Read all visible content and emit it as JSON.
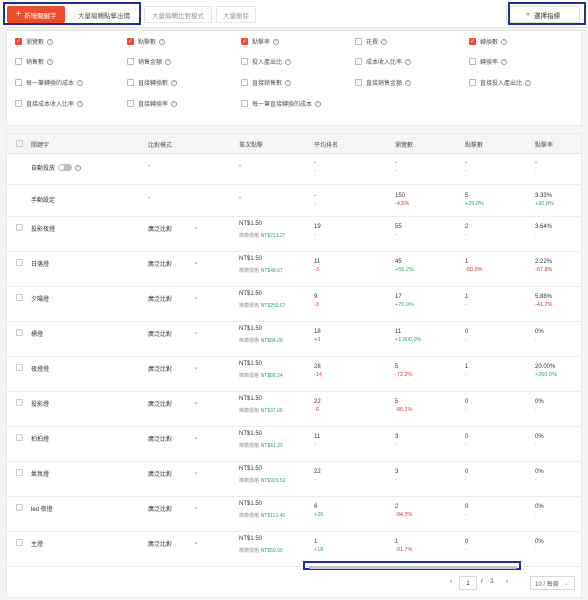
{
  "toolbar": {
    "add_label": "新增關鍵字",
    "bulk_bid_label": "大量編輯點擊出價",
    "bulk_match_label": "大量編輯比對模式",
    "bulk_delete_label": "大量刪除",
    "choose_metrics_label": "選擇指標"
  },
  "metrics": [
    {
      "label": "瀏覽數",
      "checked": true
    },
    {
      "label": "點擊數",
      "checked": true
    },
    {
      "label": "點擊率",
      "checked": true
    },
    {
      "label": "花費",
      "checked": false
    },
    {
      "label": "轉換數",
      "checked": true
    },
    {
      "label": "銷售數",
      "checked": false
    },
    {
      "label": "銷售金額",
      "checked": false
    },
    {
      "label": "投入產出比",
      "checked": false
    },
    {
      "label": "成本收入比率",
      "checked": false
    },
    {
      "label": "轉換率",
      "checked": false
    },
    {
      "label": "每一筆轉換的成本",
      "checked": false
    },
    {
      "label": "直接轉換數",
      "checked": false
    },
    {
      "label": "直接銷售數",
      "checked": false
    },
    {
      "label": "直接銷售金額",
      "checked": false
    },
    {
      "label": "直接投入產出比",
      "checked": false
    },
    {
      "label": "直接成本收入比率",
      "checked": false
    },
    {
      "label": "直接轉換率",
      "checked": false
    },
    {
      "label": "每一筆直接轉換的成本",
      "checked": false
    }
  ],
  "table": {
    "headers": [
      "關鍵字",
      "比對模式",
      "單次點擊",
      "平均排名",
      "瀏覽數",
      "點擊數",
      "點擊率"
    ],
    "auto": {
      "label": "自動投放",
      "match": "-",
      "bid": "-",
      "rank": "-",
      "rank_sub": "-",
      "views": "-",
      "views_sub": "-",
      "clicks": "-",
      "clicks_sub": "-",
      "ctr": "-",
      "ctr_sub": "-"
    },
    "manual": {
      "label": "手動設定",
      "match": "-",
      "bid": "-",
      "rank": "-",
      "rank_sub": "-",
      "views": "150",
      "views_sub": "-4.5%",
      "clicks": "5",
      "clicks_sub": "+25.0%",
      "ctr": "3.33%",
      "ctr_sub": "+30.8%"
    },
    "price_label": "推薦價格",
    "rows": [
      {
        "kw": "投影夜燈",
        "match": "廣泛比對",
        "bid": "NT$1.50",
        "price": "NT$213.27",
        "rank": "19",
        "rank_sub": "-",
        "views": "55",
        "views_sub": "-",
        "clicks": "2",
        "clicks_sub": "-",
        "ctr": "3.64%",
        "ctr_sub": "-"
      },
      {
        "kw": "日落燈",
        "match": "廣泛比對",
        "bid": "NT$1.50",
        "price": "NT$48.67",
        "rank": "11",
        "rank_sub": "-3",
        "views": "45",
        "views_sub": "+55.2%",
        "clicks": "1",
        "clicks_sub": "-50.0%",
        "ctr": "2.22%",
        "ctr_sub": "-67.8%"
      },
      {
        "kw": "夕陽燈",
        "match": "廣泛比對",
        "bid": "NT$1.50",
        "price": "NT$250.67",
        "rank": "9",
        "rank_sub": "-3",
        "views": "17",
        "views_sub": "+70.0%",
        "clicks": "1",
        "clicks_sub": "-",
        "ctr": "5.88%",
        "ctr_sub": "-41.2%"
      },
      {
        "kw": "標燈",
        "match": "廣泛比對",
        "bid": "NT$1.50",
        "price": "NT$84.29",
        "rank": "18",
        "rank_sub": "+9",
        "views": "11",
        "views_sub": "+1,000.0%",
        "clicks": "0",
        "clicks_sub": "-",
        "ctr": "0%",
        "ctr_sub": "-"
      },
      {
        "kw": "夜燈燈",
        "match": "廣泛比對",
        "bid": "NT$1.50",
        "price": "NT$88.24",
        "rank": "28",
        "rank_sub": "-14",
        "views": "5",
        "views_sub": "-72.2%",
        "clicks": "1",
        "clicks_sub": "-",
        "ctr": "20.00%",
        "ctr_sub": "+260.0%"
      },
      {
        "kw": "投影燈",
        "match": "廣泛比對",
        "bid": "NT$1.50",
        "price": "NT$37.65",
        "rank": "22",
        "rank_sub": "-6",
        "views": "5",
        "views_sub": "-86.1%",
        "clicks": "0",
        "clicks_sub": "-",
        "ctr": "0%",
        "ctr_sub": "-"
      },
      {
        "kw": "拍拍燈",
        "match": "廣泛比對",
        "bid": "NT$1.50",
        "price": "NT$41.23",
        "rank": "11",
        "rank_sub": "-",
        "views": "3",
        "views_sub": "-",
        "clicks": "0",
        "clicks_sub": "-",
        "ctr": "0%",
        "ctr_sub": "-"
      },
      {
        "kw": "氣氛燈",
        "match": "廣泛比對",
        "bid": "NT$1.50",
        "price": "NT$929.52",
        "rank": "22",
        "rank_sub": "-",
        "views": "3",
        "views_sub": "-",
        "clicks": "0",
        "clicks_sub": "-",
        "ctr": "0%",
        "ctr_sub": "-"
      },
      {
        "kw": "led 夜燈",
        "match": "廣泛比對",
        "bid": "NT$1.50",
        "price": "NT$113.46",
        "rank": "6",
        "rank_sub": "+25",
        "views": "2",
        "views_sub": "-94.3%",
        "clicks": "0",
        "clicks_sub": "-",
        "ctr": "0%",
        "ctr_sub": "-"
      },
      {
        "kw": "主燈",
        "match": "廣泛比對",
        "bid": "NT$1.50",
        "price": "NT$59.00",
        "rank": "1",
        "rank_sub": "+18",
        "views": "1",
        "views_sub": "-91.7%",
        "clicks": "0",
        "clicks_sub": "-",
        "ctr": "0%",
        "ctr_sub": "-"
      }
    ]
  },
  "pagination": {
    "current": "1",
    "separator": "/",
    "total": "3",
    "page_size": "10 / 每頁",
    "prev": "‹",
    "next": "›"
  },
  "colors": {
    "accent": "#ee4d2d",
    "positive": "#26aa5c",
    "negative": "#e0352b",
    "highlight_box": "#1f2ea0"
  }
}
